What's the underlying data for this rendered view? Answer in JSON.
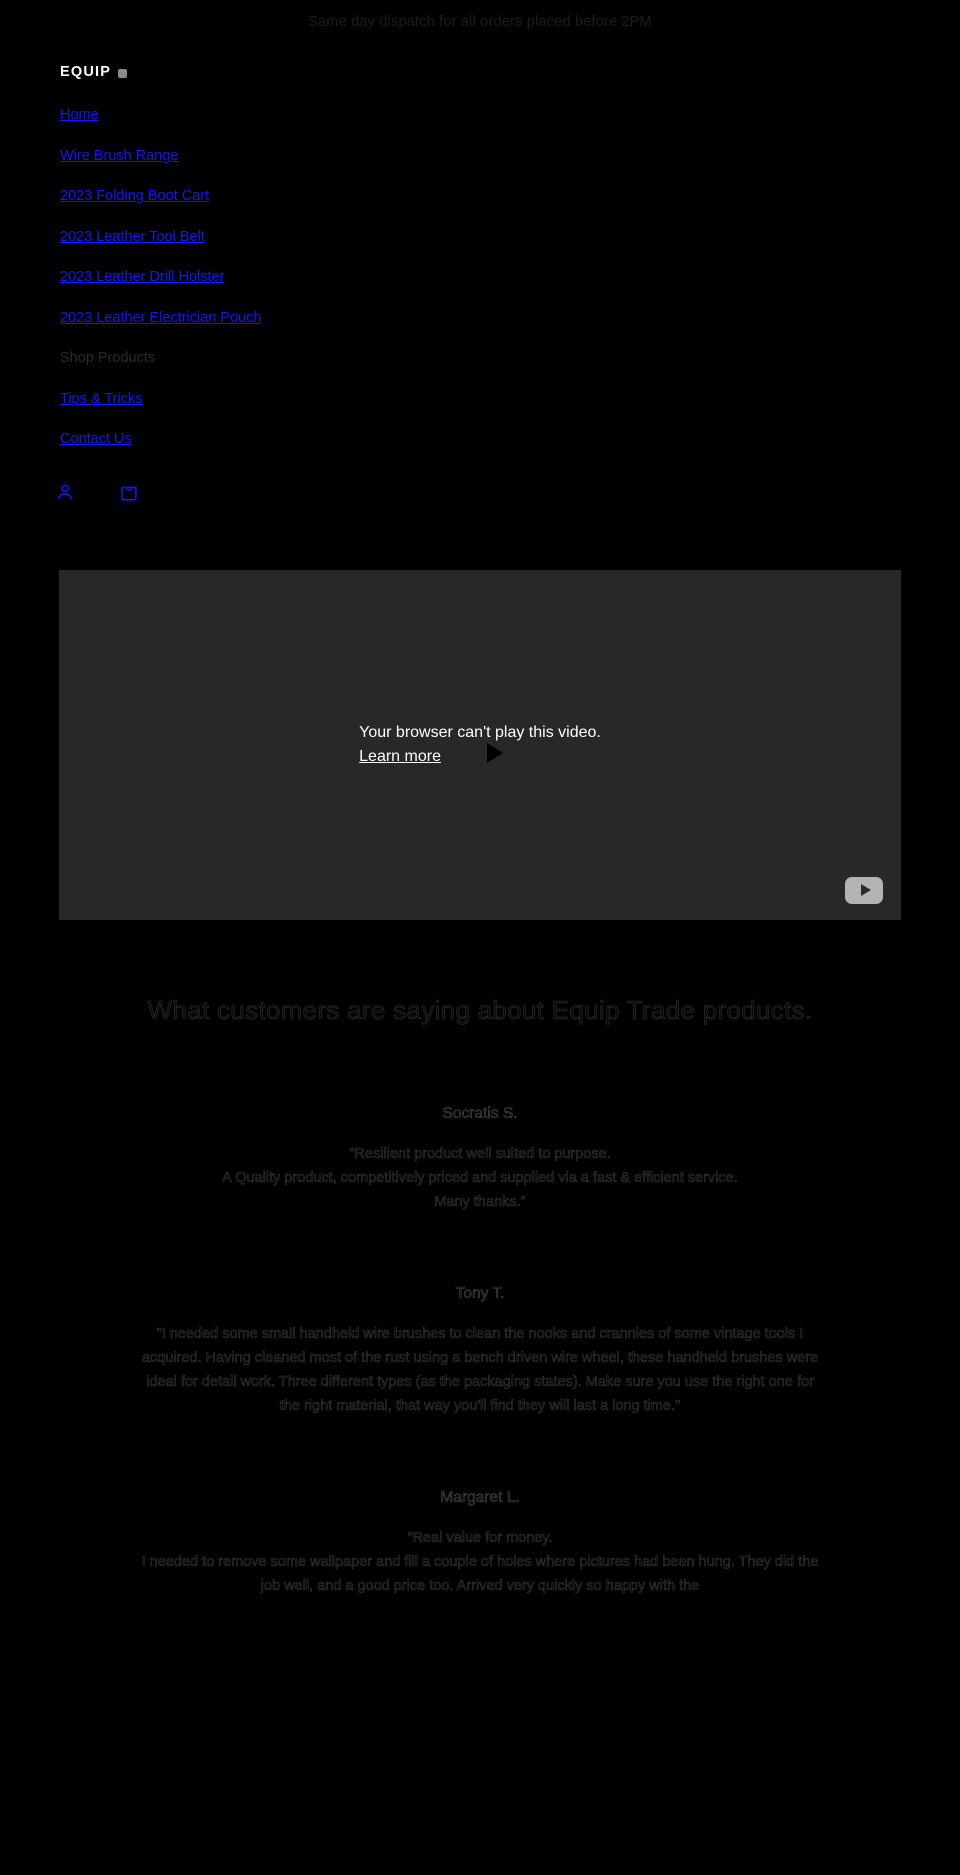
{
  "announcement": {
    "text": "Same day dispatch for all orders placed before 2PM"
  },
  "header": {
    "logo_text": "EQUIP",
    "logo_mark": "hexagon-mark"
  },
  "nav": {
    "items": [
      {
        "label": "Home",
        "muted": false
      },
      {
        "label": "Wire Brush Range",
        "muted": false
      },
      {
        "label": "2023 Folding Boot Cart",
        "muted": false
      },
      {
        "label": "2023 Leather Tool Belt",
        "muted": false
      },
      {
        "label": "2023 Leather Drill Holster",
        "muted": false
      },
      {
        "label": "2023 Leather Electrician Pouch",
        "muted": false
      },
      {
        "label": "Shop Products",
        "muted": true
      },
      {
        "label": "Tips & Tricks",
        "muted": false
      },
      {
        "label": "Contact Us",
        "muted": false
      }
    ],
    "account_icon": "person-icon",
    "cart_icon": "shopping-bag-icon"
  },
  "video": {
    "error_text": "Your browser can't play this video.",
    "learn_more": "Learn more",
    "play_icon": "play-triangle-icon",
    "badge_icon": "youtube-play-icon"
  },
  "testimonials": {
    "title": "What customers are saying about Equip Trade products.",
    "reviews": [
      {
        "name": "Socratis S.",
        "body": "\"Resilient product well suited to purpose.\nA Quality product, competitively priced and supplied via a fast & efficient service.\nMany thanks.\""
      },
      {
        "name": "Tony T.",
        "body": "\"I needed some small handheld wire brushes to clean the nooks and crannies of some vintage tools I acquired. Having cleaned most of the rust using a bench driven wire wheel, these handheld brushes were ideal for detail work. Three different types (as the packaging states). Make sure you use the right one for the right material, that way you'll find they will last a long time.\""
      },
      {
        "name": "Margaret L.",
        "body": "\"Real value for money.\nI needed to remove some wallpaper and fill a couple of holes where pictures had been hung. They did the job well, and a good price too. Arrived very quickly so happy with the"
      }
    ]
  },
  "colors": {
    "background": "#000000",
    "link": "#1414ff",
    "video_bg": "#282828",
    "logo_mark": "#8a8a8a"
  }
}
